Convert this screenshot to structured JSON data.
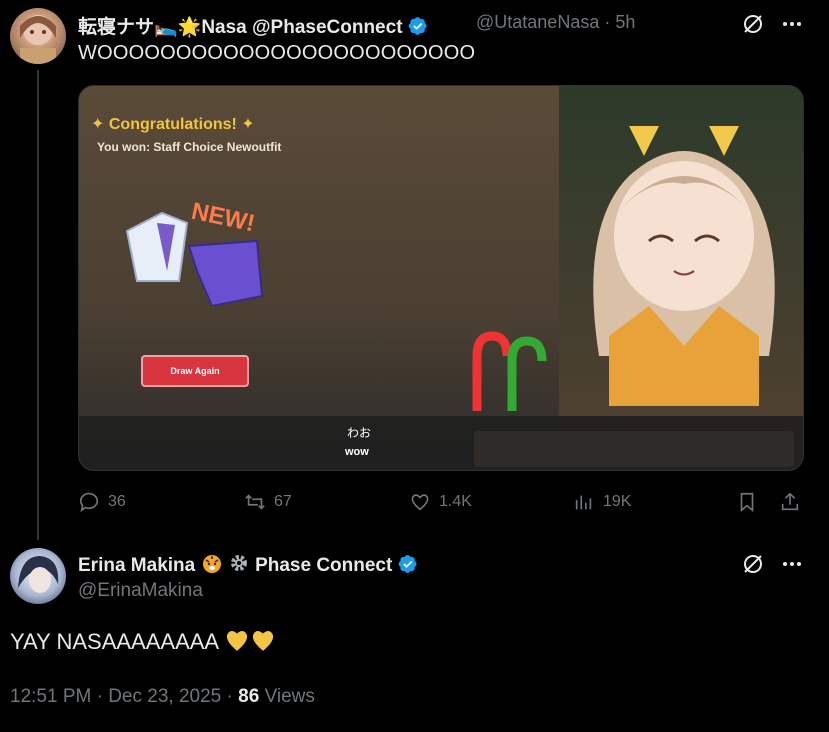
{
  "tweet1": {
    "display_name": "転寝ナサ🛌🌟Nasa @PhaseConnect",
    "handle": "@UtataneNasa",
    "time": "5h",
    "text": "WOOOOOOOOOOOOOOOOOOOOOOOO",
    "media": {
      "popup_title": "Congratulations!",
      "popup_subtitle": "You won: Staff Choice Newoutfit",
      "new_badge": "NEW!",
      "draw_button": "Draw Again",
      "subtitle_jp": "わお",
      "subtitle_en": "wow"
    },
    "actions": {
      "replies": "36",
      "reposts": "67",
      "likes": "1.4K",
      "views": "19K"
    }
  },
  "tweet2": {
    "display_name": "Erina Makina",
    "affiliation": "Phase Connect",
    "handle": "@ErinaMakina",
    "text": "YAY NASAAAAAAAA",
    "timestamp": "12:51 PM · Dec 23, 2025",
    "views_count": "86",
    "views_label": "Views"
  },
  "colors": {
    "background": "#000000",
    "text": "#e7e9ea",
    "muted": "#71767b",
    "verified_blue": "#1d9bf0",
    "heart_yellow": "#f4c542"
  }
}
